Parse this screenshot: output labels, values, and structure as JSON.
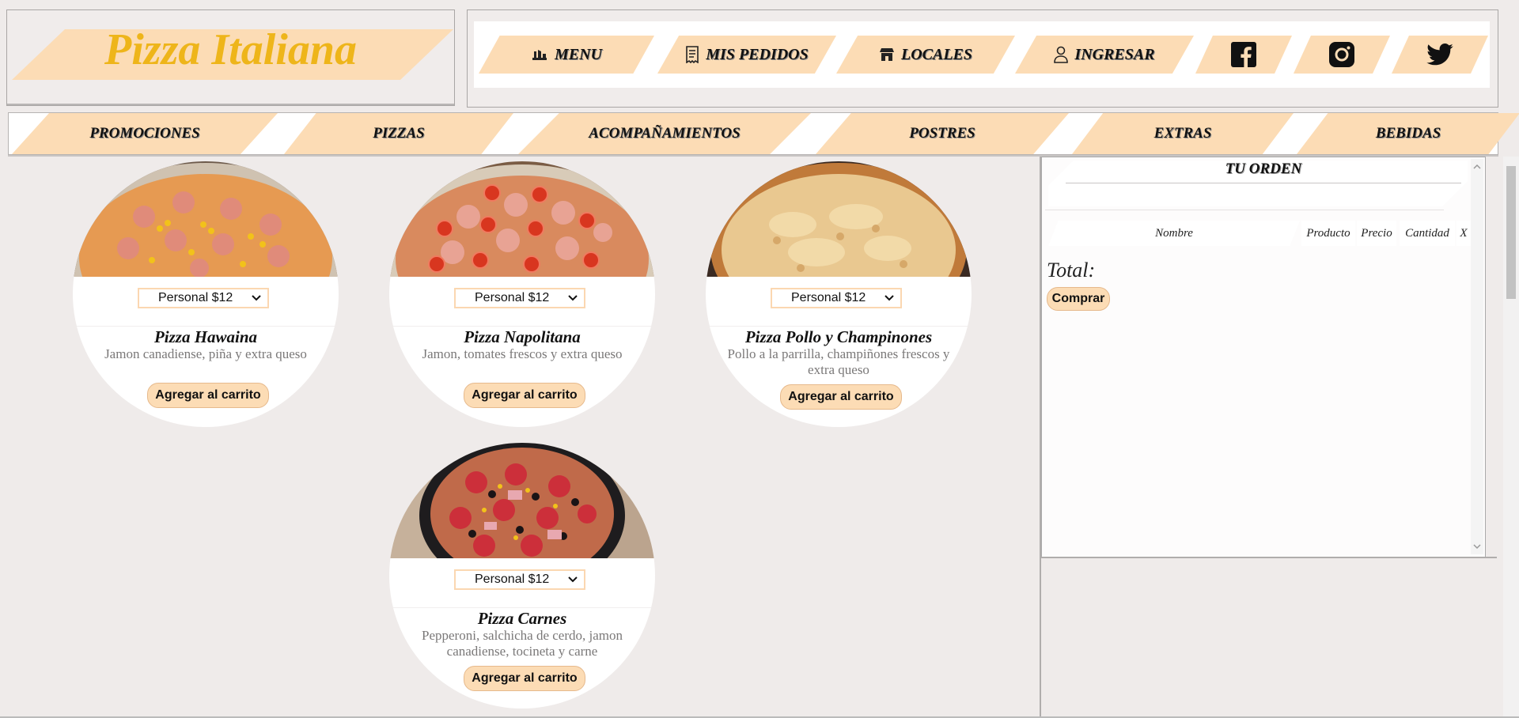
{
  "brand": {
    "name": "Pizza Italiana"
  },
  "nav": {
    "items": [
      {
        "label": "MENU",
        "icon": "fork-knife-icon"
      },
      {
        "label": "MIS PEDIDOS",
        "icon": "receipt-icon"
      },
      {
        "label": "LOCALES",
        "icon": "store-icon"
      },
      {
        "label": "INGRESAR",
        "icon": "user-icon"
      }
    ],
    "social": [
      "facebook-icon",
      "instagram-icon",
      "twitter-icon"
    ]
  },
  "categories": [
    "PROMOCIONES",
    "PIZZAS",
    "ACOMPAÑAMIENTOS",
    "POSTRES",
    "EXTRAS",
    "BEBIDAS"
  ],
  "products": [
    {
      "name": "Pizza Hawaina",
      "size": "Personal $12",
      "description": "Jamon canadiense, piña y extra queso",
      "button": "Agregar al carrito"
    },
    {
      "name": "Pizza Napolitana",
      "size": "Personal $12",
      "description": "Jamon, tomates frescos y extra queso",
      "button": "Agregar al carrito"
    },
    {
      "name": "Pizza Pollo y Champinones",
      "size": "Personal $12",
      "description": "Pollo a la parrilla, champiñones frescos y extra queso",
      "button": "Agregar al carrito"
    },
    {
      "name": "Pizza Carnes",
      "size": "Personal $12",
      "description": "Pepperoni, salchicha de cerdo, jamon canadiense, tocineta y carne",
      "button": "Agregar al carrito"
    }
  ],
  "order": {
    "title": "TU ORDEN",
    "columns": [
      "Nombre",
      "Producto",
      "Precio",
      "Cantidad",
      "X"
    ],
    "total_label": "Total:",
    "buy_button": "Comprar"
  },
  "colors": {
    "accent": "#fcdcb5",
    "brand": "#eeb51a",
    "background": "#efebea"
  }
}
